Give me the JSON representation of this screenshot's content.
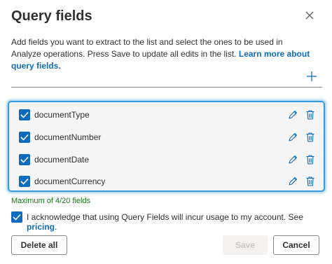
{
  "dialog": {
    "title": "Query fields",
    "description": "Add fields you want to extract to the list and select the ones to be used in Analyze operations. Press Save to update all edits in the list. ",
    "learn_more": "Learn more about query fields."
  },
  "fields": [
    {
      "label": "documentType",
      "checked": true
    },
    {
      "label": "documentNumber",
      "checked": true
    },
    {
      "label": "documentDate",
      "checked": true
    },
    {
      "label": "documentCurrency",
      "checked": true
    }
  ],
  "max_note": "Maximum of 4/20 fields",
  "acknowledge": {
    "text": "I acknowledge that using Query Fields will incur usage to my account. See ",
    "link": "pricing",
    "suffix": ".",
    "checked": true
  },
  "buttons": {
    "delete_all": "Delete all",
    "save": "Save",
    "cancel": "Cancel"
  },
  "colors": {
    "accent": "#0f6cbd",
    "highlight_border": "#3a9bdc",
    "note_green": "#107c10"
  },
  "icons": {
    "close": "close-icon",
    "add": "plus-icon",
    "edit": "pencil-icon",
    "delete": "trash-icon",
    "check": "checkmark-icon"
  }
}
